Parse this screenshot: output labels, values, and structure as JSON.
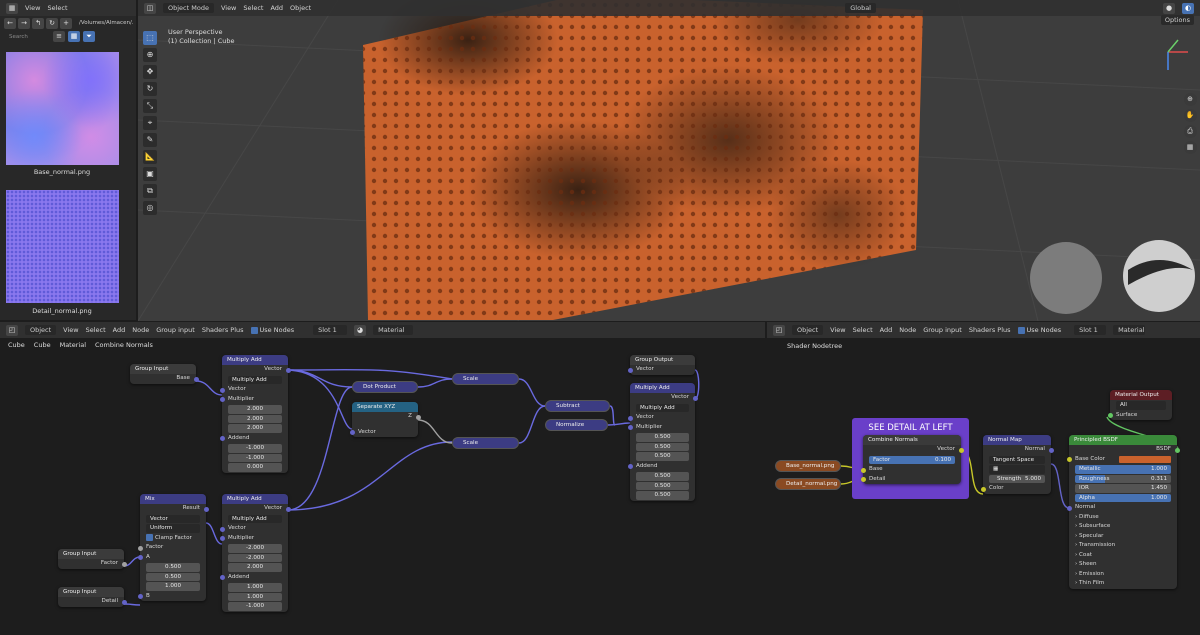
{
  "topbar": {
    "view": "View",
    "select": "Select",
    "path": "/Volumes/Almacen/...",
    "search_placeholder": "Search"
  },
  "viewport": {
    "mode": "Object Mode",
    "menus": [
      "View",
      "Select",
      "Add",
      "Object"
    ],
    "transform": "Global",
    "options": "Options",
    "info_line1": "User Perspective",
    "info_line2": "(1) Collection | Cube"
  },
  "images": [
    {
      "name": "Base_normal.png"
    },
    {
      "name": "Detail_normal.png"
    }
  ],
  "left_editor": {
    "header": {
      "mode": "Object",
      "menus": [
        "View",
        "Select",
        "Add",
        "Node",
        "Group input",
        "Shaders Plus"
      ],
      "use_nodes": "Use Nodes",
      "slot": "Slot 1",
      "material": "Material"
    },
    "breadcrumb": [
      "Cube",
      "Cube",
      "Material",
      "Combine Normals"
    ],
    "nodes": {
      "group_input_base": {
        "title": "Group Input",
        "out": "Base"
      },
      "group_input_factor": {
        "title": "Group Input",
        "out": "Factor"
      },
      "group_input_detail": {
        "title": "Group Input",
        "out": "Detail"
      },
      "mix": {
        "title": "Mix",
        "out": "Result",
        "type": "Vector",
        "mode": "Uniform",
        "clamp": "Clamp Factor",
        "factor": "Factor",
        "a": "A",
        "b": "B",
        "vals": [
          "0.500",
          "0.500",
          "1.000"
        ]
      },
      "ma1": {
        "title": "Multiply Add",
        "out": "Vector",
        "op": "Multiply Add",
        "in": "Vector",
        "mult": "Multiplier",
        "mult_vals": [
          "2.000",
          "2.000",
          "2.000"
        ],
        "addend": "Addend",
        "add_vals": [
          "-1.000",
          "-1.000",
          "0.000"
        ]
      },
      "ma2": {
        "title": "Multiply Add",
        "out": "Vector",
        "op": "Multiply Add",
        "in": "Vector",
        "mult": "Multiplier",
        "mult_vals": [
          "-2.000",
          "-2.000",
          "2.000"
        ],
        "addend": "Addend",
        "add_vals": [
          "1.000",
          "1.000",
          "-1.000"
        ]
      },
      "dot": "Dot Product",
      "sep": {
        "title": "Separate XYZ",
        "z": "Z",
        "vec": "Vector"
      },
      "scale1": "Scale",
      "scale2": "Scale",
      "subtract": "Subtract",
      "normalize": "Normalize",
      "group_output": {
        "title": "Group Output",
        "in": "Vector"
      },
      "ma3": {
        "title": "Multiply Add",
        "out": "Vector",
        "op": "Multiply Add",
        "in": "Vector",
        "mult": "Multiplier",
        "mult_vals": [
          "0.500",
          "0.500",
          "0.500"
        ],
        "addend": "Addend",
        "add_vals": [
          "0.500",
          "0.500",
          "0.500"
        ]
      }
    }
  },
  "right_editor": {
    "header": {
      "mode": "Object",
      "menus": [
        "View",
        "Select",
        "Add",
        "Node",
        "Group input",
        "Shaders Plus"
      ],
      "use_nodes": "Use Nodes",
      "slot": "Slot 1",
      "material": "Material"
    },
    "breadcrumb": "Shader Nodetree",
    "frame_label": "SEE DETAIL AT LEFT",
    "base_tex": "Base_normal.png",
    "detail_tex": "Detail_normal.png",
    "combine": {
      "title": "Combine Normals",
      "out": "Vector",
      "factor": "Factor",
      "factor_val": "0.100",
      "base": "Base",
      "detail": "Detail"
    },
    "normal_map": {
      "title": "Normal Map",
      "out": "Normal",
      "space": "Tangent Space",
      "strength": "Strength",
      "strength_val": "5.000",
      "color": "Color"
    },
    "material_output": {
      "title": "Material Output",
      "target": "All",
      "surface": "Surface"
    },
    "bsdf": {
      "title": "Principled BSDF",
      "out": "BSDF",
      "base_color": "Base Color",
      "metallic": "Metallic",
      "metallic_val": "1.000",
      "roughness": "Roughness",
      "roughness_val": "0.311",
      "ior": "IOR",
      "ior_val": "1.450",
      "alpha": "Alpha",
      "alpha_val": "1.000",
      "normal": "Normal",
      "panels": [
        "Diffuse",
        "Subsurface",
        "Specular",
        "Transmission",
        "Coat",
        "Sheen",
        "Emission",
        "Thin Film"
      ]
    }
  },
  "colors": {
    "accent": "#4772b3",
    "frame": "#6a3fc9",
    "surface": "#c9622d"
  }
}
